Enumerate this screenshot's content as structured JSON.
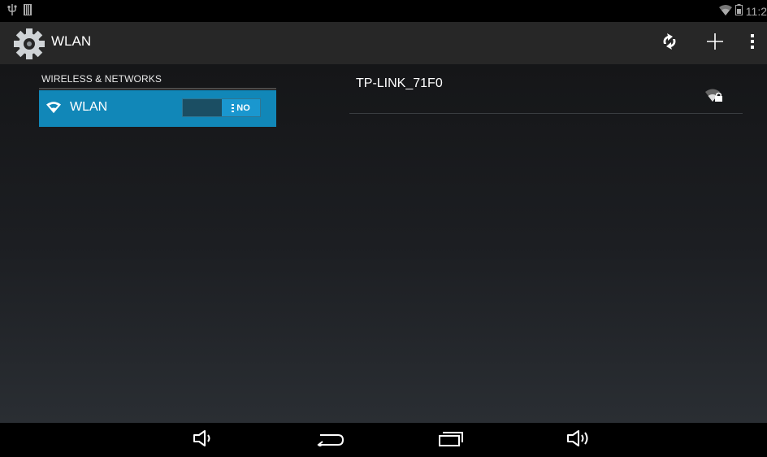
{
  "status_bar": {
    "left_icons": [
      "usb-icon",
      "sd-card-icon"
    ],
    "right_icons": [
      "wifi-icon",
      "battery-icon"
    ],
    "time": "11:2"
  },
  "action_bar": {
    "title": "WLAN",
    "app_icon": "settings-gear-icon",
    "actions": [
      "wps-icon",
      "add-icon",
      "overflow-menu-icon"
    ]
  },
  "left_pane": {
    "section_header": "WIRELESS & NETWORKS",
    "wlan_item": {
      "icon": "wifi-icon",
      "label": "WLAN",
      "toggle_label": "NO"
    }
  },
  "networks": [
    {
      "name": "TP-LINK_71F0",
      "signal_icon": "wifi-lock-icon"
    }
  ],
  "nav_bar": {
    "buttons": [
      "volume-down-icon",
      "back-icon",
      "recent-apps-icon",
      "volume-up-icon"
    ]
  },
  "colors": {
    "accent": "#1187b8",
    "toggle_thumb": "#1a97cf",
    "action_bar": "#272727"
  }
}
